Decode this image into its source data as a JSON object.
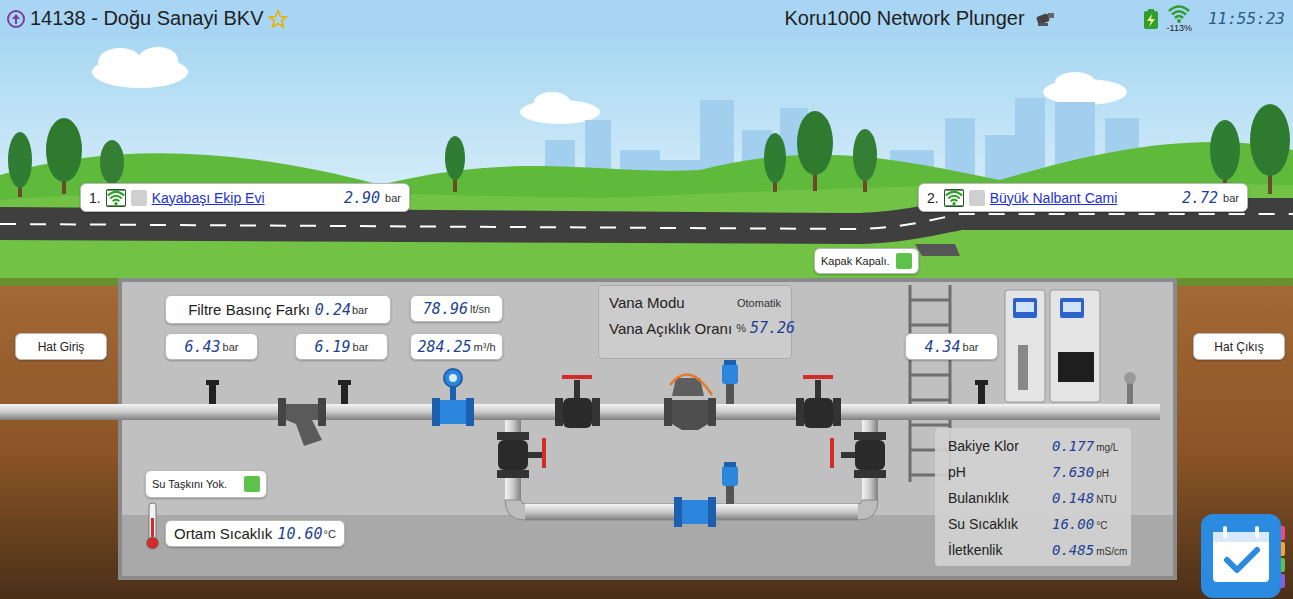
{
  "header": {
    "station": "14138 - Doğu Sanayi BKV",
    "favorite": false,
    "device": "Koru1000 Network Plunger",
    "signal": "-113%",
    "time": "11:55:23"
  },
  "sites": [
    {
      "index": "1.",
      "name": "Kayabaşı Ekip Evi",
      "value": "2.90",
      "unit": "bar",
      "online": true,
      "alarm": false
    },
    {
      "index": "2.",
      "name": "Büyük Nalbant Cami",
      "value": "2.72",
      "unit": "bar",
      "online": true,
      "alarm": false
    }
  ],
  "cover": {
    "label": "Kapak Kapalı.",
    "ok": true
  },
  "flood": {
    "label": "Su Taşkını Yok.",
    "ok": true
  },
  "ambient": {
    "label": "Ortam Sıcaklık",
    "value": "10.60",
    "unit": "°C"
  },
  "line": {
    "inlet": "Hat Giriş",
    "outlet": "Hat Çıkış"
  },
  "filter": {
    "label": "Filtre Basınç Farkı",
    "value": "0.24",
    "unit": "bar"
  },
  "pressures": [
    {
      "value": "6.43",
      "unit": "bar"
    },
    {
      "value": "6.19",
      "unit": "bar"
    },
    {
      "value": "4.34",
      "unit": "bar"
    }
  ],
  "flow": [
    {
      "value": "78.96",
      "unit": "lt/sn"
    },
    {
      "value": "284.25",
      "unit": "m³/h"
    }
  ],
  "valve": {
    "mode_label": "Vana Modu",
    "mode": "Otomatik",
    "opening_label": "Vana Açıklık Oranı",
    "opening_unit": "%",
    "opening": "57.26"
  },
  "quality": [
    {
      "label": "Bakiye Klor",
      "value": "0.177",
      "unit": "mg/L"
    },
    {
      "label": "pH",
      "value": "7.630",
      "unit": "pH"
    },
    {
      "label": "Bulanıklık",
      "value": "0.148",
      "unit": "NTU"
    },
    {
      "label": "Su Sıcaklık",
      "value": "16.00",
      "unit": "°C"
    },
    {
      "label": "İletkenlik",
      "value": "0.485",
      "unit": "mS/cm"
    }
  ]
}
